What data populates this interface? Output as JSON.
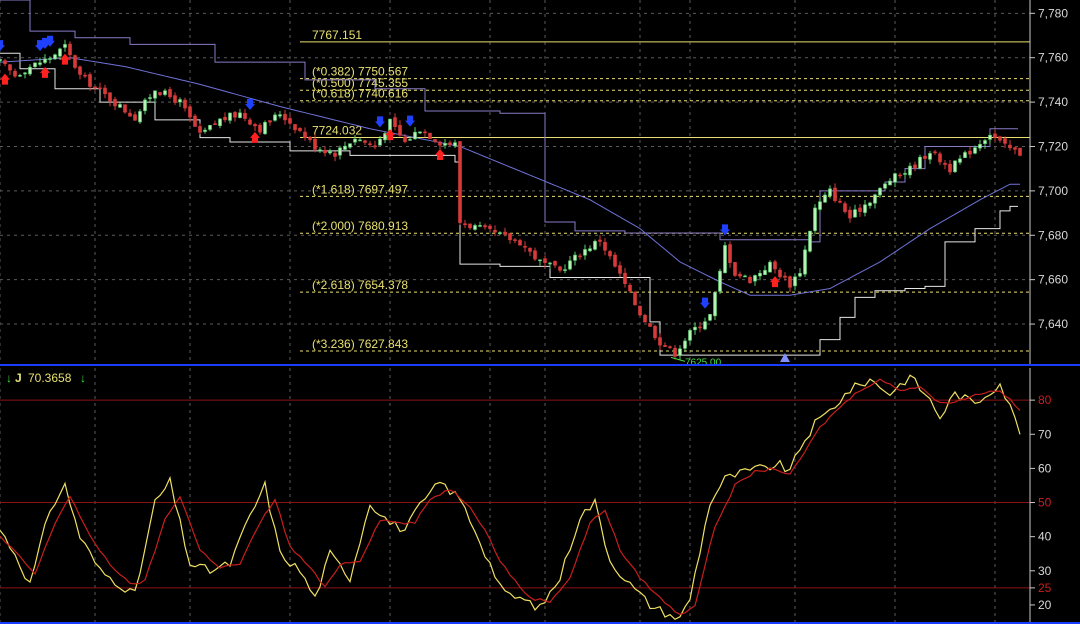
{
  "chart_data": [
    {
      "type": "candlestick",
      "y_ticks": [
        "7,780",
        "7,760",
        "7,740",
        "7,720",
        "7,700",
        "7,680",
        "7,660",
        "7,640"
      ],
      "y_tick_values": [
        7780,
        7760,
        7740,
        7720,
        7700,
        7680,
        7660,
        7640
      ],
      "ylim": [
        7622,
        7786
      ],
      "x_count": 205,
      "grid": true,
      "fib_levels": [
        {
          "label": "7767.151",
          "value": 7767.151,
          "style": "solid"
        },
        {
          "label": "(*0.382) 7750.567",
          "value": 7750.567,
          "style": "dashed"
        },
        {
          "label": "(*0.500) 7745.355",
          "value": 7745.355,
          "style": "dashed"
        },
        {
          "label": "(*0.618) 7740.616",
          "value": 7740.616,
          "style": "dashed"
        },
        {
          "label": "7724.032",
          "value": 7724.032,
          "style": "solid"
        },
        {
          "label": "(*1.618) 7697.497",
          "value": 7697.497,
          "style": "dashed"
        },
        {
          "label": "(*2.000) 7680.913",
          "value": 7680.913,
          "style": "dashed"
        },
        {
          "label": "(*2.618) 7654.378",
          "value": 7654.378,
          "style": "dashed"
        },
        {
          "label": "(*3.236) 7627.843",
          "value": 7627.843,
          "style": "dashed"
        }
      ],
      "low_label": "7625.00",
      "low_value": 7625.0,
      "close_anchors": [
        [
          0,
          7758
        ],
        [
          3,
          7752
        ],
        [
          6,
          7756
        ],
        [
          10,
          7760
        ],
        [
          13,
          7765
        ],
        [
          16,
          7752
        ],
        [
          20,
          7745
        ],
        [
          24,
          7738
        ],
        [
          27,
          7733
        ],
        [
          31,
          7746
        ],
        [
          36,
          7740
        ],
        [
          40,
          7725
        ],
        [
          44,
          7732
        ],
        [
          48,
          7735
        ],
        [
          52,
          7728
        ],
        [
          56,
          7735
        ],
        [
          60,
          7727
        ],
        [
          63,
          7720
        ],
        [
          67,
          7717
        ],
        [
          71,
          7724
        ],
        [
          75,
          7720
        ],
        [
          78,
          7731
        ],
        [
          81,
          7722
        ],
        [
          84,
          7728
        ],
        [
          88,
          7722
        ],
        [
          91,
          7721
        ],
        [
          92,
          7686
        ],
        [
          96,
          7683
        ],
        [
          100,
          7680
        ],
        [
          104,
          7677
        ],
        [
          108,
          7668
        ],
        [
          112,
          7664
        ],
        [
          116,
          7672
        ],
        [
          120,
          7678
        ],
        [
          124,
          7662
        ],
        [
          128,
          7645
        ],
        [
          132,
          7632
        ],
        [
          135,
          7627
        ],
        [
          138,
          7636
        ],
        [
          142,
          7644
        ],
        [
          144,
          7663
        ],
        [
          145,
          7675
        ],
        [
          147,
          7663
        ],
        [
          150,
          7660
        ],
        [
          154,
          7667
        ],
        [
          158,
          7658
        ],
        [
          160,
          7664
        ],
        [
          163,
          7692
        ],
        [
          166,
          7700
        ],
        [
          170,
          7688
        ],
        [
          174,
          7696
        ],
        [
          178,
          7705
        ],
        [
          182,
          7710
        ],
        [
          186,
          7718
        ],
        [
          190,
          7710
        ],
        [
          194,
          7718
        ],
        [
          198,
          7726
        ],
        [
          201,
          7720
        ],
        [
          204,
          7717
        ]
      ],
      "upper_band_steps": [
        [
          0,
          7786
        ],
        [
          6,
          7772
        ],
        [
          15,
          7769
        ],
        [
          26,
          7766
        ],
        [
          38,
          7766
        ],
        [
          43,
          7758
        ],
        [
          53,
          7758
        ],
        [
          61,
          7750
        ],
        [
          75,
          7746
        ],
        [
          85,
          7736
        ],
        [
          100,
          7735
        ],
        [
          108,
          7735
        ],
        [
          109,
          7686
        ],
        [
          115,
          7682
        ],
        [
          125,
          7681
        ],
        [
          135,
          7681
        ],
        [
          144,
          7678
        ],
        [
          162,
          7677
        ],
        [
          164,
          7700
        ],
        [
          173,
          7700
        ],
        [
          177,
          7704
        ],
        [
          181,
          7710
        ],
        [
          185,
          7720
        ],
        [
          196,
          7720
        ],
        [
          198,
          7728
        ],
        [
          202,
          7728
        ]
      ],
      "lower_band_steps": [
        [
          0,
          7762
        ],
        [
          4,
          7755
        ],
        [
          11,
          7746
        ],
        [
          20,
          7740
        ],
        [
          31,
          7732
        ],
        [
          40,
          7724
        ],
        [
          46,
          7722
        ],
        [
          58,
          7718
        ],
        [
          70,
          7716
        ],
        [
          78,
          7716
        ],
        [
          91,
          7713
        ],
        [
          92,
          7667
        ],
        [
          100,
          7666
        ],
        [
          110,
          7661
        ],
        [
          123,
          7661
        ],
        [
          130,
          7641
        ],
        [
          132,
          7626
        ],
        [
          157,
          7626
        ],
        [
          160,
          7626
        ],
        [
          164,
          7633
        ],
        [
          168,
          7643
        ],
        [
          171,
          7652
        ],
        [
          175,
          7655
        ],
        [
          181,
          7656
        ],
        [
          185,
          7657
        ],
        [
          189,
          7677
        ],
        [
          195,
          7683
        ],
        [
          200,
          7691
        ],
        [
          202,
          7693
        ]
      ],
      "ma_anchors": [
        [
          0,
          7758
        ],
        [
          14,
          7760
        ],
        [
          25,
          7756
        ],
        [
          40,
          7748
        ],
        [
          56,
          7738
        ],
        [
          74,
          7728
        ],
        [
          92,
          7720
        ],
        [
          105,
          7708
        ],
        [
          118,
          7696
        ],
        [
          128,
          7683
        ],
        [
          136,
          7668
        ],
        [
          144,
          7659
        ],
        [
          150,
          7653
        ],
        [
          158,
          7653
        ],
        [
          166,
          7656
        ],
        [
          176,
          7668
        ],
        [
          186,
          7683
        ],
        [
          196,
          7696
        ],
        [
          202,
          7703
        ]
      ],
      "buy_arrows": [
        0,
        8,
        9,
        10,
        50,
        76,
        82,
        141,
        145
      ],
      "sell_arrows": [
        1,
        9,
        13,
        51,
        78,
        88,
        155
      ],
      "up_triangle_index": 157
    },
    {
      "type": "line",
      "indicator_name": "J",
      "indicator_value": "70.3658",
      "y_ticks_white": [
        "70",
        "60",
        "40",
        "30",
        "20"
      ],
      "y_ticks_white_values": [
        70,
        60,
        40,
        30,
        20
      ],
      "y_ticks_red": [
        "80",
        "50",
        "25"
      ],
      "y_ticks_red_values": [
        80,
        50,
        25
      ],
      "ylim": [
        15,
        90
      ],
      "x_count": 205,
      "series": [
        {
          "color": "#f0e060",
          "values_anchors": [
            [
              0,
              42
            ],
            [
              3,
              35
            ],
            [
              6,
              26
            ],
            [
              10,
              48
            ],
            [
              13,
              55
            ],
            [
              16,
              40
            ],
            [
              20,
              30
            ],
            [
              24,
              26
            ],
            [
              27,
              23
            ],
            [
              31,
              50
            ],
            [
              34,
              56
            ],
            [
              38,
              32
            ],
            [
              42,
              30
            ],
            [
              46,
              32
            ],
            [
              50,
              46
            ],
            [
              53,
              55
            ],
            [
              56,
              35
            ],
            [
              60,
              30
            ],
            [
              63,
              22
            ],
            [
              66,
              35
            ],
            [
              70,
              28
            ],
            [
              74,
              50
            ],
            [
              78,
              44
            ],
            [
              81,
              42
            ],
            [
              84,
              49
            ],
            [
              88,
              56
            ],
            [
              92,
              51
            ],
            [
              95,
              42
            ],
            [
              98,
              32
            ],
            [
              101,
              23
            ],
            [
              104,
              22
            ],
            [
              108,
              19
            ],
            [
              112,
              28
            ],
            [
              116,
              46
            ],
            [
              119,
              50
            ],
            [
              122,
              33
            ],
            [
              126,
              26
            ],
            [
              130,
              20
            ],
            [
              134,
              17
            ],
            [
              136,
              16
            ],
            [
              138,
              22
            ],
            [
              142,
              50
            ],
            [
              145,
              57
            ],
            [
              149,
              59
            ],
            [
              152,
              60
            ],
            [
              156,
              61
            ],
            [
              158,
              59
            ],
            [
              160,
              66
            ],
            [
              163,
              73
            ],
            [
              166,
              77
            ],
            [
              170,
              83
            ],
            [
              174,
              86
            ],
            [
              178,
              82
            ],
            [
              182,
              87
            ],
            [
              186,
              80
            ],
            [
              188,
              75
            ],
            [
              191,
              82
            ],
            [
              195,
              79
            ],
            [
              200,
              85
            ],
            [
              204,
              71
            ]
          ]
        },
        {
          "color": "#c81e1e",
          "values_anchors": [
            [
              0,
              40
            ],
            [
              4,
              34
            ],
            [
              7,
              29
            ],
            [
              11,
              44
            ],
            [
              14,
              52
            ],
            [
              18,
              40
            ],
            [
              22,
              32
            ],
            [
              26,
              26
            ],
            [
              29,
              27
            ],
            [
              33,
              45
            ],
            [
              36,
              52
            ],
            [
              40,
              36
            ],
            [
              44,
              31
            ],
            [
              48,
              32
            ],
            [
              52,
              44
            ],
            [
              55,
              51
            ],
            [
              58,
              37
            ],
            [
              62,
              31
            ],
            [
              65,
              25
            ],
            [
              68,
              32
            ],
            [
              72,
              33
            ],
            [
              76,
              45
            ],
            [
              80,
              44
            ],
            [
              83,
              44
            ],
            [
              86,
              51
            ],
            [
              90,
              54
            ],
            [
              94,
              49
            ],
            [
              97,
              42
            ],
            [
              100,
              33
            ],
            [
              103,
              27
            ],
            [
              106,
              22
            ],
            [
              110,
              21
            ],
            [
              114,
              28
            ],
            [
              118,
              44
            ],
            [
              121,
              48
            ],
            [
              124,
              36
            ],
            [
              128,
              28
            ],
            [
              132,
              22
            ],
            [
              136,
              17
            ],
            [
              139,
              20
            ],
            [
              143,
              43
            ],
            [
              147,
              55
            ],
            [
              151,
              59
            ],
            [
              155,
              60
            ],
            [
              158,
              58
            ],
            [
              161,
              65
            ],
            [
              164,
              72
            ],
            [
              168,
              78
            ],
            [
              172,
              83
            ],
            [
              176,
              86
            ],
            [
              180,
              83
            ],
            [
              184,
              84
            ],
            [
              188,
              79
            ],
            [
              192,
              80
            ],
            [
              196,
              82
            ],
            [
              200,
              83
            ],
            [
              204,
              77
            ]
          ]
        }
      ],
      "hlines": [
        80,
        50,
        25
      ]
    }
  ],
  "colors": {
    "background": "#000000",
    "grid": "#5a5a5a",
    "bull": "#58d06c",
    "bear": "#d83a3a",
    "bull_dot": "#b8f0b8",
    "band": "#e6e6e6",
    "band_upper": "#8a7ac8",
    "ma": "#6f72d8",
    "fib": "#e8e070",
    "divider": "#1a3cff",
    "buy_arrow": "#2040ff",
    "sell_arrow": "#ff2020",
    "triangle": "#8090ff",
    "low_label": "#40e040",
    "indicator_arrow": "#40e040"
  }
}
